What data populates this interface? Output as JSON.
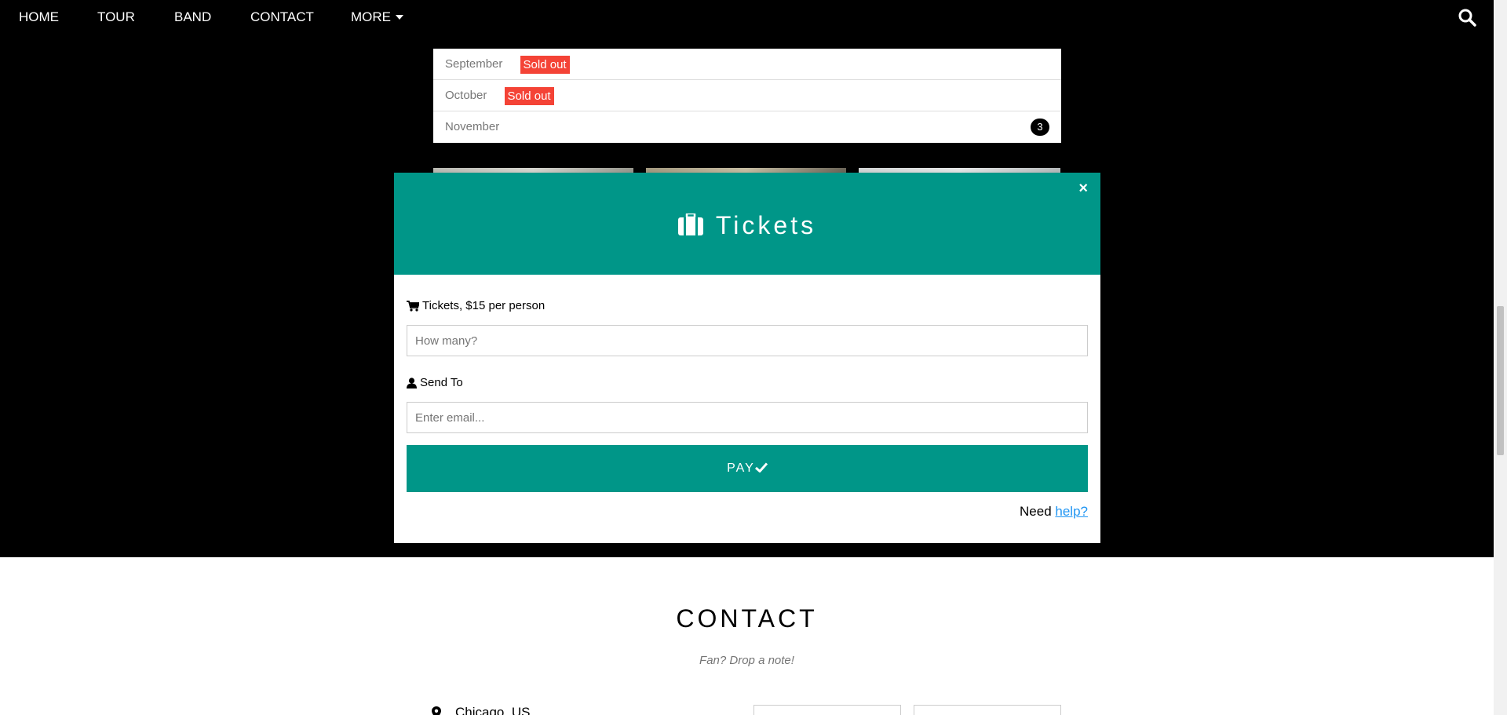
{
  "nav": {
    "items": [
      "HOME",
      "TOUR",
      "BAND",
      "CONTACT"
    ],
    "more_label": "MORE"
  },
  "tour": {
    "months": [
      {
        "name": "September",
        "badge": "Sold out"
      },
      {
        "name": "October",
        "badge": "Sold out"
      },
      {
        "name": "November",
        "count": "3"
      }
    ]
  },
  "modal": {
    "title": "Tickets",
    "close": "×",
    "tickets_label": "Tickets, $15 per person",
    "tickets_placeholder": "How many?",
    "send_label": "Send To",
    "email_placeholder": "Enter email...",
    "pay_label": "PAY",
    "help_prefix": "Need",
    "help_link": "help?"
  },
  "contact": {
    "title": "CONTACT",
    "subtitle": "Fan? Drop a note!",
    "location": "Chicago, US"
  },
  "colors": {
    "accent": "#009688",
    "sold_out": "#f44336",
    "link": "#2196F3"
  },
  "icons": [
    "search-icon",
    "caret-down-icon",
    "suitcase-icon",
    "cart-icon",
    "user-icon",
    "check-icon",
    "map-marker-icon",
    "close-icon"
  ]
}
